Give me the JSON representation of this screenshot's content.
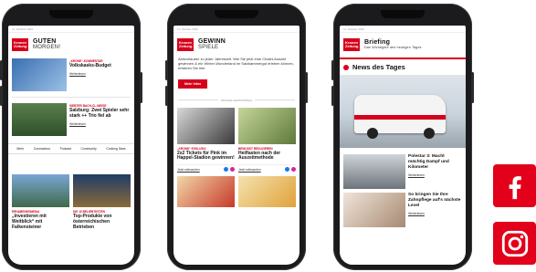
{
  "phone1": {
    "date": "11. Oktober 2023",
    "logo": "Kronen Zeitung",
    "title1": "GUTEN",
    "title2": "MORGEN!",
    "story1": {
      "kicker": "„KRONE“-KOMMENTAR",
      "headline": "Volkskasks-Budget",
      "more": "Weiterlesen"
    },
    "story2": {
      "kicker": "SIEBTER BACH-CL-WEISE",
      "headline": "Salzburg: Zwei Spieler sehr stark ++ Trio fiel ab",
      "more": "Weiterlesen"
    },
    "nav": [
      "Mehr",
      "Coronavirus",
      "Podcast",
      "Community",
      "Cooking Stars"
    ],
    "card1": {
      "kicker": "ERHABENESMEDIA",
      "headline": "„Investieren mit Weitblick“ mit Falkensteiner"
    },
    "card2": {
      "kicker": "DIE 10 BELIEBTESTEN",
      "headline": "Top-Produkte von österreichischen Betrieben"
    }
  },
  "phone2": {
    "date": "11. Oktober 2023",
    "logo": "Kronen Zeitung",
    "title1": "GEWINN",
    "title2": "SPIELE",
    "intro": "Aktivurlauber zu jeder Jahreszeit. Wie Sie jetzt eine Chalet-Auszeit gewinnen & ein Winter-Wunderland im Salzkammergut erleben können, erfahren Sie hier.",
    "button": "Mehr Infos",
    "separator": "WEITERE GEWINNSPIELE",
    "card1": {
      "kicker": "„KRONE“ EXKLUSIV",
      "headline": "2x2 Tickets für Pink im Happel-Stadion gewinnen!",
      "more": "Jetzt mitmachen"
    },
    "card2": {
      "kicker": "BEWUSST REDUZIEREN",
      "headline": "Heilfasten nach der Auszeitmethode",
      "more": "Jetzt mitmachen"
    }
  },
  "phone3": {
    "date": "11. Oktober 2023",
    "logo": "Kronen Zeitung",
    "title1": "Briefing",
    "title2": "Das Wichtigste des heutigen Tages",
    "section": "News des Tages",
    "row1": {
      "headline": "Polestar 3: Macht mächtig Dampf und Kilometer",
      "more": "Weiterlesen"
    },
    "row2": {
      "headline": "So bringen Sie Ihre Zahnpflege auf's nächste Level",
      "more": "Weiterlesen"
    }
  },
  "social": {
    "facebook_icon": "facebook-icon",
    "instagram_icon": "instagram-icon",
    "color": "#e2001a"
  }
}
